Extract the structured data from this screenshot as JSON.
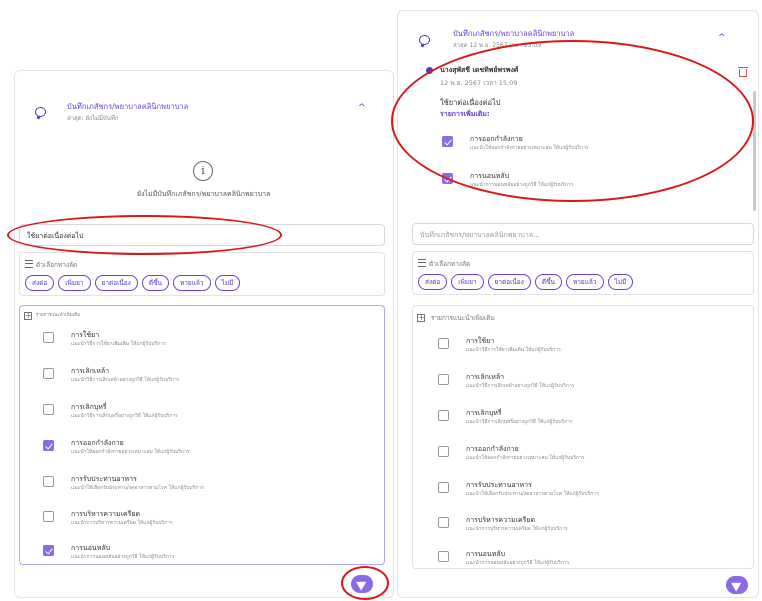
{
  "left": {
    "header": {
      "title": "บันทึกเภสัชกร/พยาบาลคลินิกพยาบาล",
      "subtitle": "ล่าสุด: ยังไม่มีบันทึก",
      "caret": "^"
    },
    "empty_message": "ยังไม่มีบันทึกเภสัชกร/พยาบาลคลินิกพยาบาล",
    "input_value": "ใช้ยาต่อเนื่องต่อไป",
    "options": {
      "title": "ตัวเลือกทางลัด",
      "chips": [
        "ส่งต่อ",
        "เพิ่มยา",
        "ยาต่อเนื่อง",
        "ดีขึ้น",
        "หายแล้ว",
        "ไม่มี"
      ]
    },
    "recommend": {
      "title": "รายการแนะนำเพิ่มเติม",
      "items": [
        {
          "title": "การใช้ยา",
          "desc": "แนะนำวิธีการใช้ยาเพิ่มเติม ให้แก่ผู้รับบริการ",
          "checked": false
        },
        {
          "title": "การเลิกเหล้า",
          "desc": "แนะนำวิธีการเลิกเหล้าอย่างถูกวิธี ให้แก่ผู้รับบริการ",
          "checked": false
        },
        {
          "title": "การเลิกบุหรี่",
          "desc": "แนะนำวิธีการเลิกบุหรี่อย่างถูกวิธี ให้แก่ผู้รับบริการ",
          "checked": false
        },
        {
          "title": "การออกกำลังกาย",
          "desc": "แนะนำให้ออกกำลังกายอย่างเหมาะสม ให้แก่ผู้รับบริการ",
          "checked": true
        },
        {
          "title": "การรับประทานอาหาร",
          "desc": "แนะนำให้เลือกรับประทาน/งดอาหารตามโรค ให้แก่ผู้รับบริการ",
          "checked": false
        },
        {
          "title": "การบริหารความเครียด",
          "desc": "แนะนำการบริหารความเครียด ให้แก่ผู้รับบริการ",
          "checked": false
        },
        {
          "title": "การนอนหลับ",
          "desc": "แนะนำการนอนหลับอย่างถูกวิธี ให้แก่ผู้รับบริการ",
          "checked": true
        }
      ]
    }
  },
  "right": {
    "header": {
      "title": "บันทึกเภสัชกร/พยาบาลคลินิกพยาบาล",
      "subtitle": "ล่าสุด 12 พ.ย. 2567 เวลา 15:09",
      "caret": "^"
    },
    "note": {
      "author": "นางสุพัสชี เดชทิพย์พรพงศ์",
      "datetime": "12 พ.ย. 2567 เวลา 15:09",
      "text": "ใช้ยาต่อเนื่องต่อไป",
      "extra_label": "รายการเพิ่มเติม:",
      "items": [
        {
          "title": "การออกกำลังกาย",
          "desc": "แนะนำให้ออกกำลังกายอย่างเหมาะสม ให้แก่ผู้รับบริการ"
        },
        {
          "title": "การนอนหลับ",
          "desc": "แนะนำการนอนหลับอย่างถูกวิธี ให้แก่ผู้รับบริการ"
        }
      ]
    },
    "input_placeholder": "บันทึกเภสัชกร/พยาบาลคลินิกพยาบาล...",
    "options": {
      "title": "ตัวเลือกทางลัด",
      "chips": [
        "ส่งต่อ",
        "เพิ่มยา",
        "ยาต่อเนื่อง",
        "ดีขึ้น",
        "หายแล้ว",
        "ไม่มี"
      ]
    },
    "recommend": {
      "title": "รายการแนะนำเพิ่มเติม",
      "items": [
        {
          "title": "การใช้ยา",
          "desc": "แนะนำวิธีการใช้ยาเพิ่มเติม ให้แก่ผู้รับบริการ",
          "checked": false
        },
        {
          "title": "การเลิกเหล้า",
          "desc": "แนะนำวิธีการเลิกเหล้าอย่างถูกวิธี ให้แก่ผู้รับบริการ",
          "checked": false
        },
        {
          "title": "การเลิกบุหรี่",
          "desc": "แนะนำวิธีการเลิกบุหรี่อย่างถูกวิธี ให้แก่ผู้รับบริการ",
          "checked": false
        },
        {
          "title": "การออกกำลังกาย",
          "desc": "แนะนำให้ออกกำลังกายอย่างเหมาะสม ให้แก่ผู้รับบริการ",
          "checked": false
        },
        {
          "title": "การรับประทานอาหาร",
          "desc": "แนะนำให้เลือกรับประทาน/งดอาหารตามโรค ให้แก่ผู้รับบริการ",
          "checked": false
        },
        {
          "title": "การบริหารความเครียด",
          "desc": "แนะนำการบริหารความเครียด ให้แก่ผู้รับบริการ",
          "checked": false
        },
        {
          "title": "การนอนหลับ",
          "desc": "แนะนำการนอนหลับอย่างถูกวิธี ให้แก่ผู้รับบริการ",
          "checked": false
        }
      ]
    }
  },
  "colors": {
    "accent": "#6b3fd6",
    "checkbox_on": "#8b6ae6",
    "highlight": "#d91818"
  }
}
